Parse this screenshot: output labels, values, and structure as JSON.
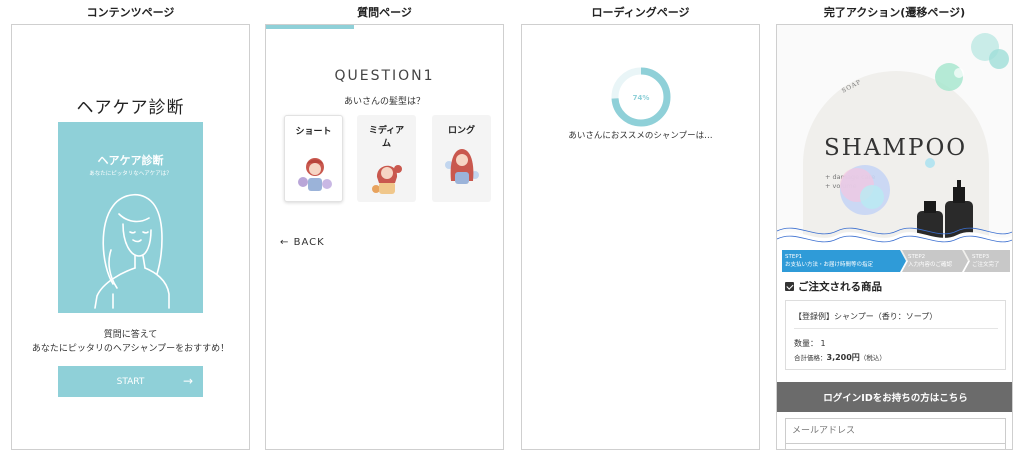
{
  "captions": {
    "content": "コンテンツページ",
    "question": "質問ページ",
    "loading": "ローディングページ",
    "complete": "完了アクション(遷移ページ)"
  },
  "content_page": {
    "title": "ヘアケア診断",
    "card_title": "ヘアケア診断",
    "card_subtitle": "あなたにピッタリなヘアケアは？",
    "desc_line1": "質問に答えて",
    "desc_line2": "あなたにピッタリのヘアシャンプーをおすすめ！",
    "start_label": "START",
    "accent": "#8fd0d8"
  },
  "question_page": {
    "question_label": "QUESTION1",
    "question_text": "あいさんの髪型は？",
    "options": [
      {
        "label": "ショート",
        "selected": true
      },
      {
        "label": "ミディア\nム",
        "selected": false
      },
      {
        "label": "ロング",
        "selected": false
      }
    ],
    "back_label": "BACK"
  },
  "loading_page": {
    "percent": "74%",
    "progress": 0.74,
    "text": "あいさんにおススメのシャンプーは…"
  },
  "complete_page": {
    "hero": {
      "soap": "SOAP",
      "shampoo": "SHAMPOO",
      "line1": "+ damage care",
      "line2": "+ volume"
    },
    "steps": [
      {
        "step": "STEP1",
        "label": "お支払い方法・お届け時間等の指定",
        "active": true
      },
      {
        "step": "STEP2",
        "label": "入力内容のご確認",
        "active": false
      },
      {
        "step": "STEP3",
        "label": "ご注文完了",
        "active": false
      }
    ],
    "order_heading": "ご注文される商品",
    "item_name": "【登録例】シャンプー（香り：ソープ）",
    "quantity": "数量： 1",
    "total_label": "合計価格：",
    "total_value": "3,200円",
    "tax_note": "（税込）",
    "login_label": "ログインIDをお持ちの方はこちら",
    "email_placeholder": "メールアドレス"
  }
}
